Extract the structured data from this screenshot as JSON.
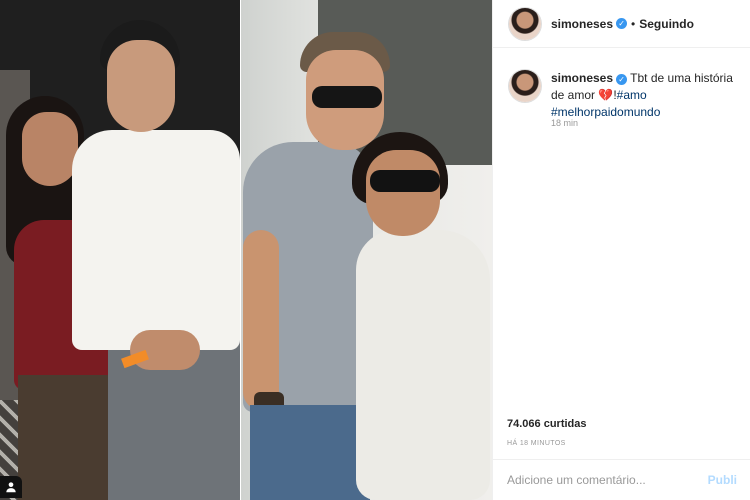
{
  "post": {
    "username": "simoneses",
    "follow_status": "Seguindo",
    "separator": "•",
    "caption": {
      "text": "Tbt de uma história de amor",
      "emoji": "💔",
      "suffix": "!",
      "hashtags": [
        "#amo",
        "#melhorpaidomundo"
      ]
    },
    "time_ago": "18 min",
    "likes": "74.066 curtidas",
    "posted_ago": "HÁ 18 MINUTOS",
    "comment_placeholder": "Adicione um comentário...",
    "publish_label": "Publi"
  },
  "icons": {
    "verified": "verified-badge-icon",
    "corner": "user-tag-icon"
  },
  "colors": {
    "verified_blue": "#3897f0",
    "hashtag_blue": "#003569",
    "publish_disabled": "#b3dbff",
    "muted_text": "#999999"
  }
}
